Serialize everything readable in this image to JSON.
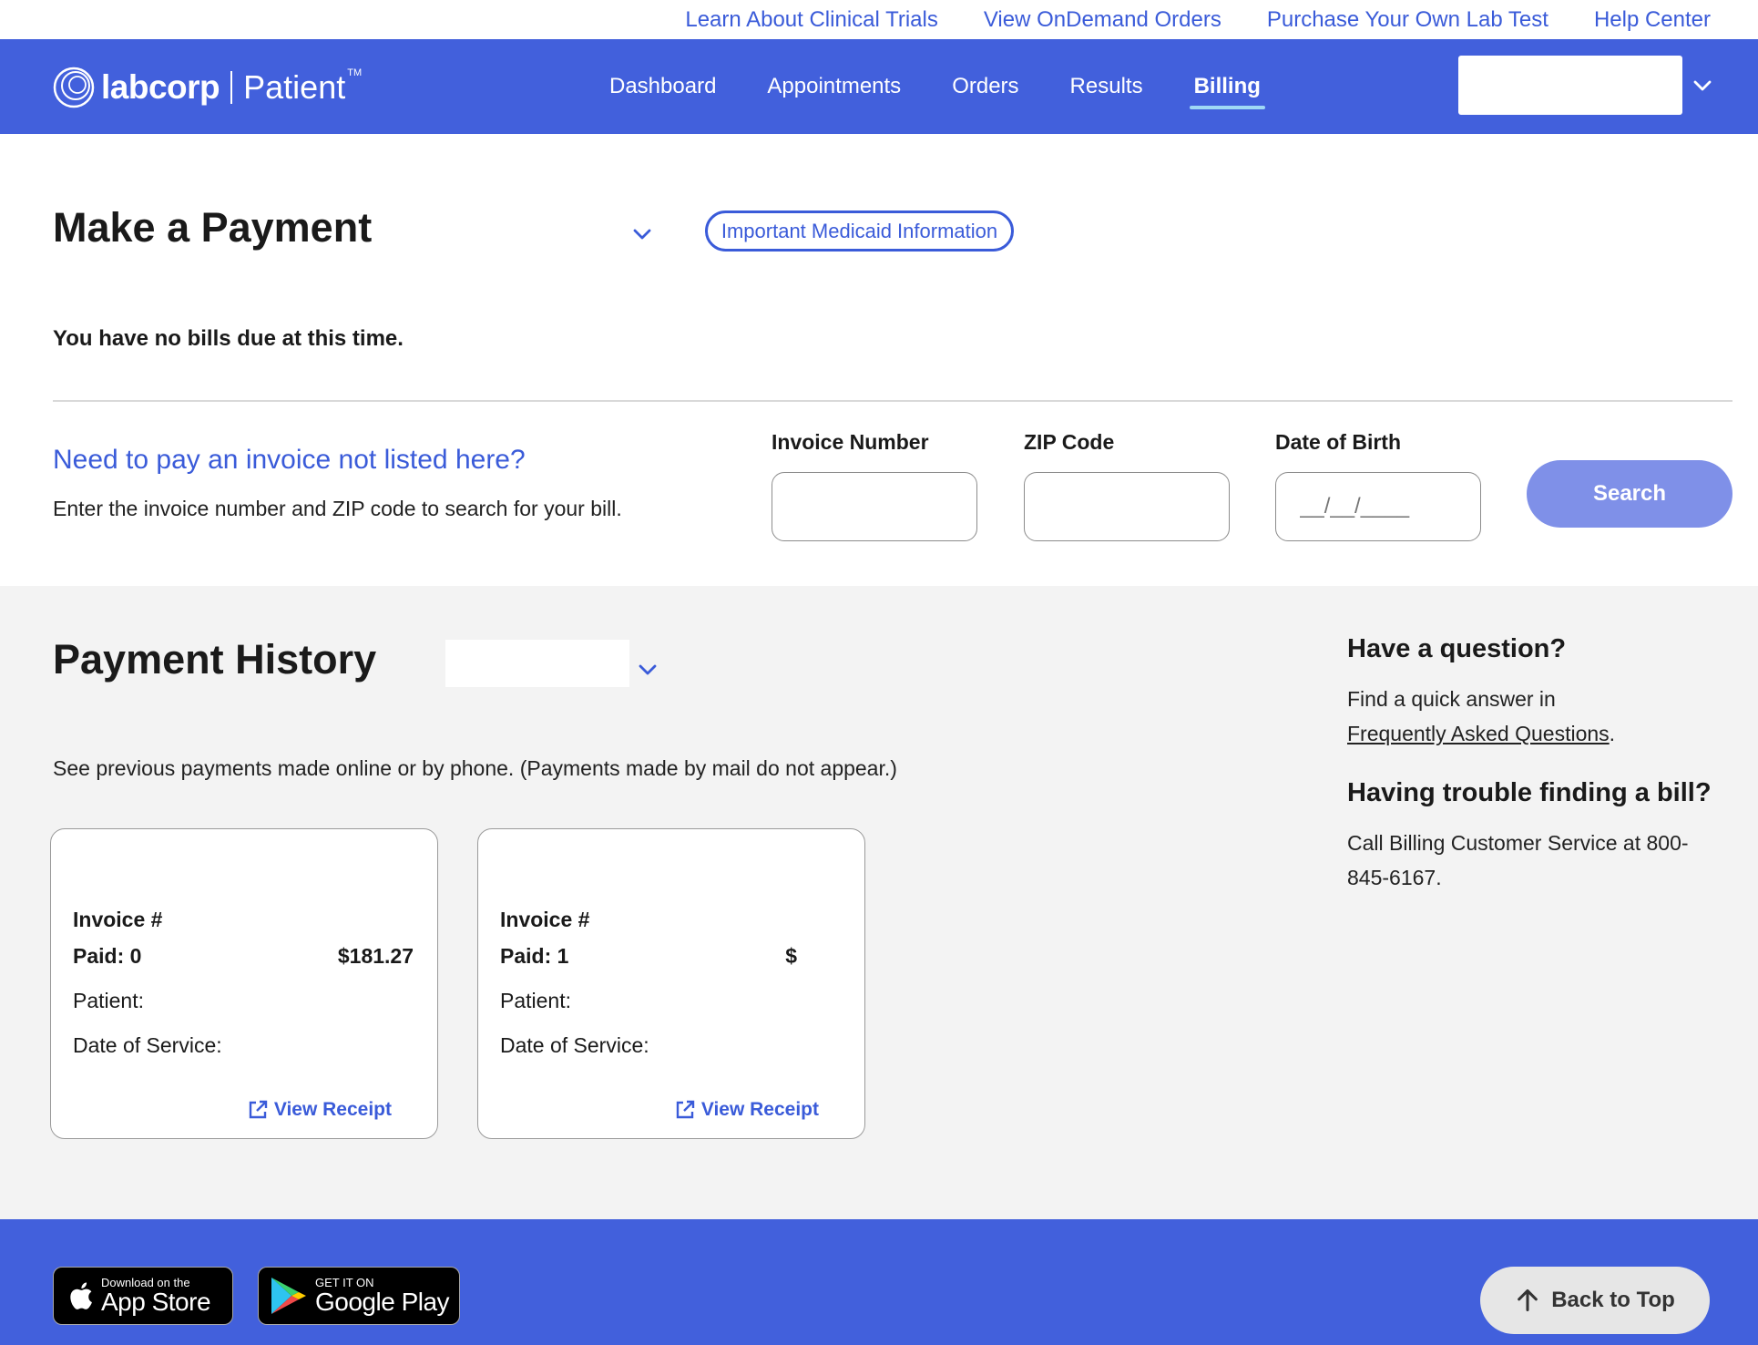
{
  "utility_nav": [
    "Learn About Clinical Trials",
    "View OnDemand Orders",
    "Purchase Your Own Lab Test",
    "Help Center"
  ],
  "brand": {
    "name": "labcorp",
    "product": "Patient",
    "tm": "TM"
  },
  "main_nav": [
    {
      "label": "Dashboard"
    },
    {
      "label": "Appointments"
    },
    {
      "label": "Orders"
    },
    {
      "label": "Results"
    },
    {
      "label": "Billing",
      "active": true
    }
  ],
  "payment": {
    "title": "Make a Payment",
    "medicaid_button": "Important Medicaid Information",
    "no_bills": "You have no bills due at this time.",
    "invoice_title": "Need to pay an invoice not listed here?",
    "invoice_sub": "Enter the invoice number and ZIP code to search for your bill.",
    "fields": {
      "invoice_label": "Invoice Number",
      "zip_label": "ZIP Code",
      "dob_label": "Date of Birth",
      "dob_placeholder": "__/__/____"
    },
    "search_button": "Search"
  },
  "history": {
    "title": "Payment History",
    "description": "See previous payments made online or by phone. (Payments made by mail do not appear.)",
    "cards": [
      {
        "invoice": "Invoice #",
        "paid": "Paid: 0",
        "amount": "$181.27",
        "patient": "Patient:",
        "date_of_service": "Date of Service:",
        "receipt": "View Receipt"
      },
      {
        "invoice": "Invoice #",
        "paid": "Paid: 1",
        "amount": "$",
        "patient": "Patient:",
        "date_of_service": "Date of Service:",
        "receipt": "View Receipt"
      }
    ],
    "aside": {
      "question_title": "Have a question?",
      "question_text": "Find a quick answer in",
      "faq_link": "Frequently Asked Questions",
      "faq_suffix": ".",
      "trouble_title": "Having trouble finding a bill?",
      "trouble_text": "Call Billing Customer Service at 800-845-6167."
    }
  },
  "footer": {
    "app_store": {
      "small": "Download on the",
      "big": "App Store"
    },
    "google_play": {
      "small": "GET IT ON",
      "big": "Google Play"
    },
    "back_to_top": "Back to Top"
  },
  "colors": {
    "brand_blue": "#4260dc",
    "link_blue": "#3a5bd9",
    "search_button": "#7f90e8",
    "section_gray": "#f3f3f3"
  }
}
